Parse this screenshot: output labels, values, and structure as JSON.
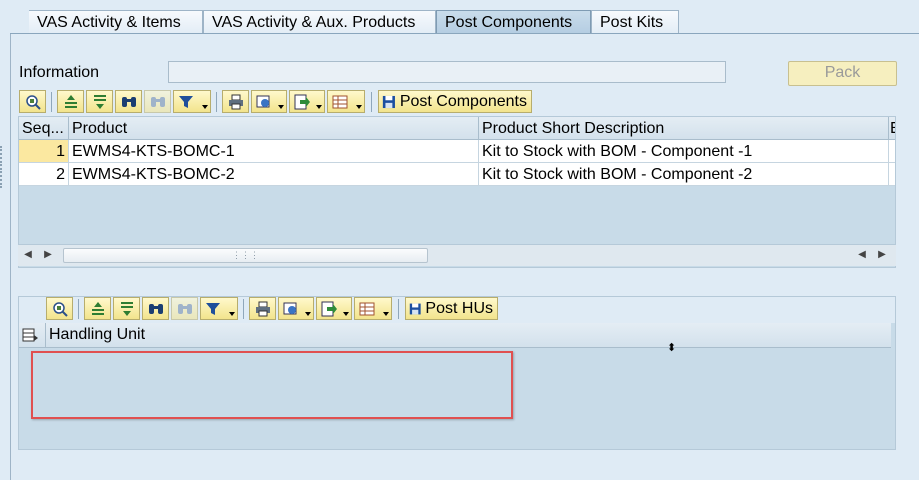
{
  "tabs": [
    {
      "label": "VAS Activity & Items"
    },
    {
      "label": "VAS Activity & Aux. Products"
    },
    {
      "label": "Post Components"
    },
    {
      "label": "Post Kits"
    }
  ],
  "info": {
    "label": "Information",
    "value": ""
  },
  "pack_button": "Pack",
  "toolbar1": {
    "post_label": "Post Components"
  },
  "grid": {
    "columns": [
      "Seq...",
      "Product",
      "Product Short Description",
      "E"
    ],
    "rows": [
      {
        "seq": "1",
        "product": "EWMS4-KTS-BOMC-1",
        "description": "Kit to Stock with BOM - Component -1"
      },
      {
        "seq": "2",
        "product": "EWMS4-KTS-BOMC-2",
        "description": "Kit to Stock with BOM - Component -2"
      }
    ]
  },
  "toolbar2": {
    "post_label": "Post HUs"
  },
  "hu_table": {
    "column": "Handling Unit"
  },
  "icons": [
    "details-icon",
    "sort-ascending-icon",
    "sort-descending-icon",
    "find-icon",
    "find-next-icon",
    "filter-icon",
    "print-icon",
    "views-icon",
    "export-icon",
    "layout-icon",
    "save-post-icon"
  ],
  "colors": {
    "accent_button": "#f6efbf",
    "highlight_box": "#e05050",
    "selected_cell": "#fbe8a0"
  }
}
